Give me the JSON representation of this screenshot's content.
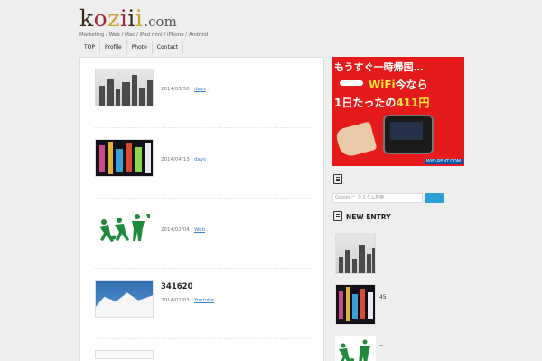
{
  "site": {
    "logo_main": "koziii",
    "logo_tld": ".com",
    "tagline": "Marketing / Web / Mac / iPad mini / iPhone / Android"
  },
  "nav": [
    "TOP",
    "Profile",
    "Photo",
    "Contact"
  ],
  "posts": [
    {
      "date": "2014/05/30",
      "category": "days",
      "title": ""
    },
    {
      "date": "2014/04/13",
      "category": "days",
      "title": ""
    },
    {
      "date": "2014/02/04",
      "category": "Web",
      "title": ""
    },
    {
      "date": "2014/02/03",
      "category": "Youtube",
      "title": "341620"
    }
  ],
  "ad": {
    "line1": "もうすぐ一時帰国…",
    "wifi": "WiFi",
    "wifi_suffix": "今なら",
    "line3_prefix": "1日たったの",
    "line3_price": "411円",
    "url": "WiFi-RENT.COM"
  },
  "sidebar": {
    "search_placeholder": "Google™ カスタム検索",
    "new_entry_title": "NEW ENTRY",
    "entries": [
      {
        "count": ""
      },
      {
        "count": "45"
      },
      {
        "count": "--"
      }
    ]
  },
  "colors": {
    "link": "#3a7dc5",
    "search_button": "#2a9fd6",
    "ad_red": "#e51a1a",
    "ad_yellow": "#ffe33a",
    "green_art": "#1f8a3a"
  }
}
